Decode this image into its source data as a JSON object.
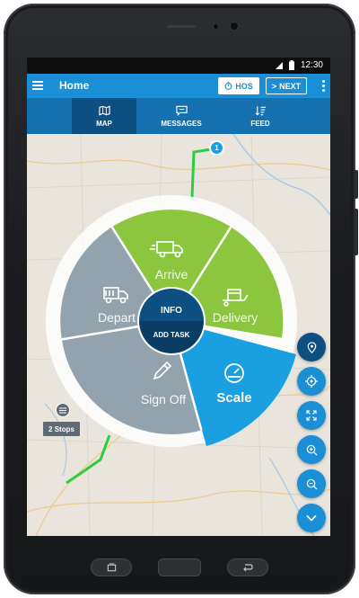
{
  "status_bar": {
    "time": "12:30"
  },
  "app_bar": {
    "title": "Home",
    "hos_label": "HOS",
    "next_label": "NEXT"
  },
  "tabs": [
    {
      "label": "MAP",
      "icon": "map-icon",
      "active": true
    },
    {
      "label": "MESSAGES",
      "icon": "message-icon",
      "active": false
    },
    {
      "label": "FEED",
      "icon": "sort-icon",
      "active": false
    }
  ],
  "map": {
    "marker_label": "1",
    "stops_label": "2 Stops"
  },
  "radial_menu": {
    "center_top": "INFO",
    "center_bottom": "ADD TASK",
    "segments": [
      {
        "label": "Arrive",
        "icon": "truck-icon",
        "color": "#8cc63f"
      },
      {
        "label": "Delivery",
        "icon": "delivery-box-icon",
        "color": "#8cc63f"
      },
      {
        "label": "Scale",
        "icon": "gauge-icon",
        "color": "#1a9fe0"
      },
      {
        "label": "Sign Off",
        "icon": "pen-icon",
        "color": "#93a3ad"
      },
      {
        "label": "Depart",
        "icon": "truck-icon",
        "color": "#93a3ad"
      }
    ]
  },
  "colors": {
    "app_bar": "#1a8fd6",
    "tab_bar": "#1570b0",
    "tab_active": "#0d4f80",
    "green": "#8cc63f",
    "blue": "#1a9fe0",
    "gray": "#93a3ad",
    "center": "#0d4f80"
  }
}
